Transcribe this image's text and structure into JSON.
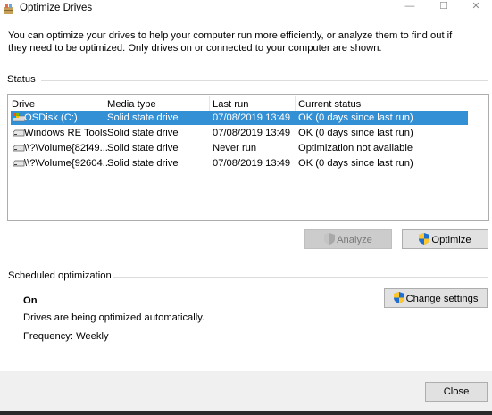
{
  "window": {
    "title": "Optimize Drives",
    "min_glyph": "—",
    "max_glyph": "☐",
    "close_glyph": "✕"
  },
  "intro_text": "You can optimize your drives to help your computer run more efficiently, or analyze them to find out if they need to be optimized. Only drives on or connected to your computer are shown.",
  "status": {
    "label": "Status",
    "columns": [
      "Drive",
      "Media type",
      "Last run",
      "Current status"
    ],
    "rows": [
      {
        "drive": "OSDisk (C:)",
        "media": "Solid state drive",
        "last_run": "07/08/2019 13:49",
        "status": "OK (0 days since last run)",
        "icon": "os-drive-icon"
      },
      {
        "drive": "Windows RE Tools",
        "media": "Solid state drive",
        "last_run": "07/08/2019 13:49",
        "status": "OK (0 days since last run)",
        "icon": "drive-icon"
      },
      {
        "drive": "\\\\?\\Volume{82f49...",
        "media": "Solid state drive",
        "last_run": "Never run",
        "status": "Optimization not available",
        "icon": "drive-icon"
      },
      {
        "drive": "\\\\?\\Volume{92604...",
        "media": "Solid state drive",
        "last_run": "07/08/2019 13:49",
        "status": "OK (0 days since last run)",
        "icon": "drive-icon"
      }
    ],
    "selected_row": 0
  },
  "buttons": {
    "analyze": "Analyze",
    "optimize": "Optimize",
    "change_settings": "Change settings",
    "close": "Close"
  },
  "scheduled": {
    "title": "Scheduled optimization",
    "state": "On",
    "description": "Drives are being optimized automatically.",
    "frequency": "Frequency: Weekly"
  },
  "colors": {
    "selection": "#3390d5",
    "footer": "#f0f0f0"
  }
}
